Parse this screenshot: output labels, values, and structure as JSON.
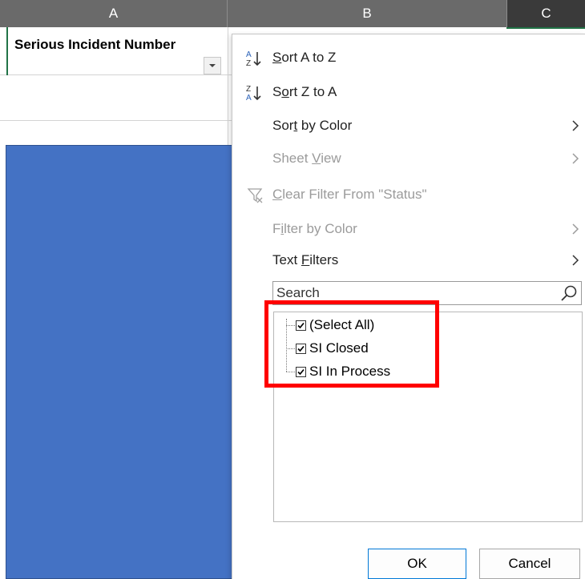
{
  "columns": {
    "a": "A",
    "b": "B",
    "c": "C"
  },
  "cell_a1": "Serious Incident Number",
  "menu": {
    "sort_az": "Sort A to Z",
    "sort_za": "Sort Z to A",
    "sort_by_color": "Sort by Color",
    "sheet_view": "Sheet View",
    "clear_filter": "Clear Filter From \"Status\"",
    "filter_by_color": "Filter by Color",
    "text_filters": "Text Filters"
  },
  "search": {
    "placeholder": "Search"
  },
  "filter_items": [
    {
      "label": "(Select All)",
      "checked": true
    },
    {
      "label": "SI Closed",
      "checked": true
    },
    {
      "label": "SI In Process",
      "checked": true
    }
  ],
  "buttons": {
    "ok": "OK",
    "cancel": "Cancel"
  },
  "colors": {
    "header_bg": "#6a6a6a",
    "selected_col_bg": "#3a3a3a",
    "shape_fill": "#4472c4",
    "highlight": "#ff0000",
    "excel_green": "#217346"
  },
  "icons": [
    "sort-az-icon",
    "sort-za-icon",
    "clear-filter-icon",
    "chevron-right-icon",
    "search-icon",
    "dropdown-arrow-icon",
    "checkbox-checked-icon"
  ]
}
